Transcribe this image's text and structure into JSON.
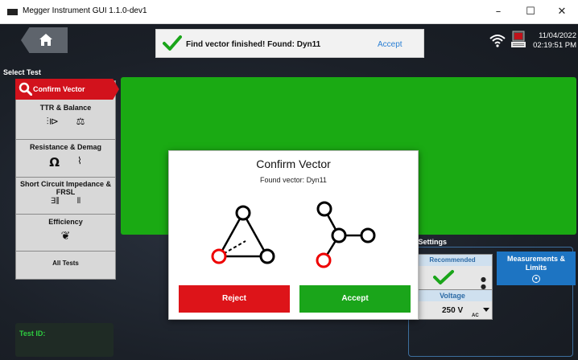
{
  "window": {
    "title": "Megger Instrument GUI 1.1.0-dev1",
    "minimize_glyph": "–",
    "maximize_glyph": "☐",
    "close_glyph": "✕"
  },
  "header": {
    "home_icon": "home-icon",
    "toast": {
      "message": "Find vector finished! Found: Dyn11",
      "action": "Accept"
    },
    "date": "11/04/2022",
    "time": "02:19:51 PM"
  },
  "sidebar": {
    "title": "Select Test",
    "active": {
      "label": "Confirm Vector"
    },
    "items": [
      {
        "label": "TTR & Balance",
        "icons": [
          "transformer-icon",
          "balance-scale-icon"
        ],
        "glyphs": [
          "⫶⧐",
          "⚖"
        ]
      },
      {
        "label": "Resistance & Demag",
        "icons": [
          "ohm-icon",
          "demag-icon"
        ],
        "glyphs": [
          "Ω",
          "⌇"
        ]
      },
      {
        "label": "Short Circuit Impedance & FRSL",
        "icons": [
          "impedance-icon",
          "frsl-icon"
        ],
        "glyphs": [
          "∃⫼",
          "⦀"
        ]
      },
      {
        "label": "Efficiency",
        "icons": [
          "leaf-icon"
        ],
        "glyphs": [
          "❦"
        ]
      },
      {
        "label": "All Tests",
        "icons": [],
        "glyphs": []
      }
    ],
    "test_id_label": "Test ID:"
  },
  "settings": {
    "title": "t Settings",
    "recommended_label": "Recommended",
    "recommended_dots": "● ●",
    "measurements_label": "Measurements & Limits",
    "voltage_label": "Voltage",
    "voltage_value": "250 V",
    "voltage_unit": "AC"
  },
  "dialog": {
    "title": "Confirm Vector",
    "subtitle": "Found vector: Dyn11",
    "reject_label": "Reject",
    "accept_label": "Accept"
  },
  "colors": {
    "accent_red": "#d2121c",
    "green_panel": "#1aaa13",
    "accept_green": "#1aa51a",
    "blue_button": "#1d74c2",
    "toast_link": "#2a7fd4"
  }
}
